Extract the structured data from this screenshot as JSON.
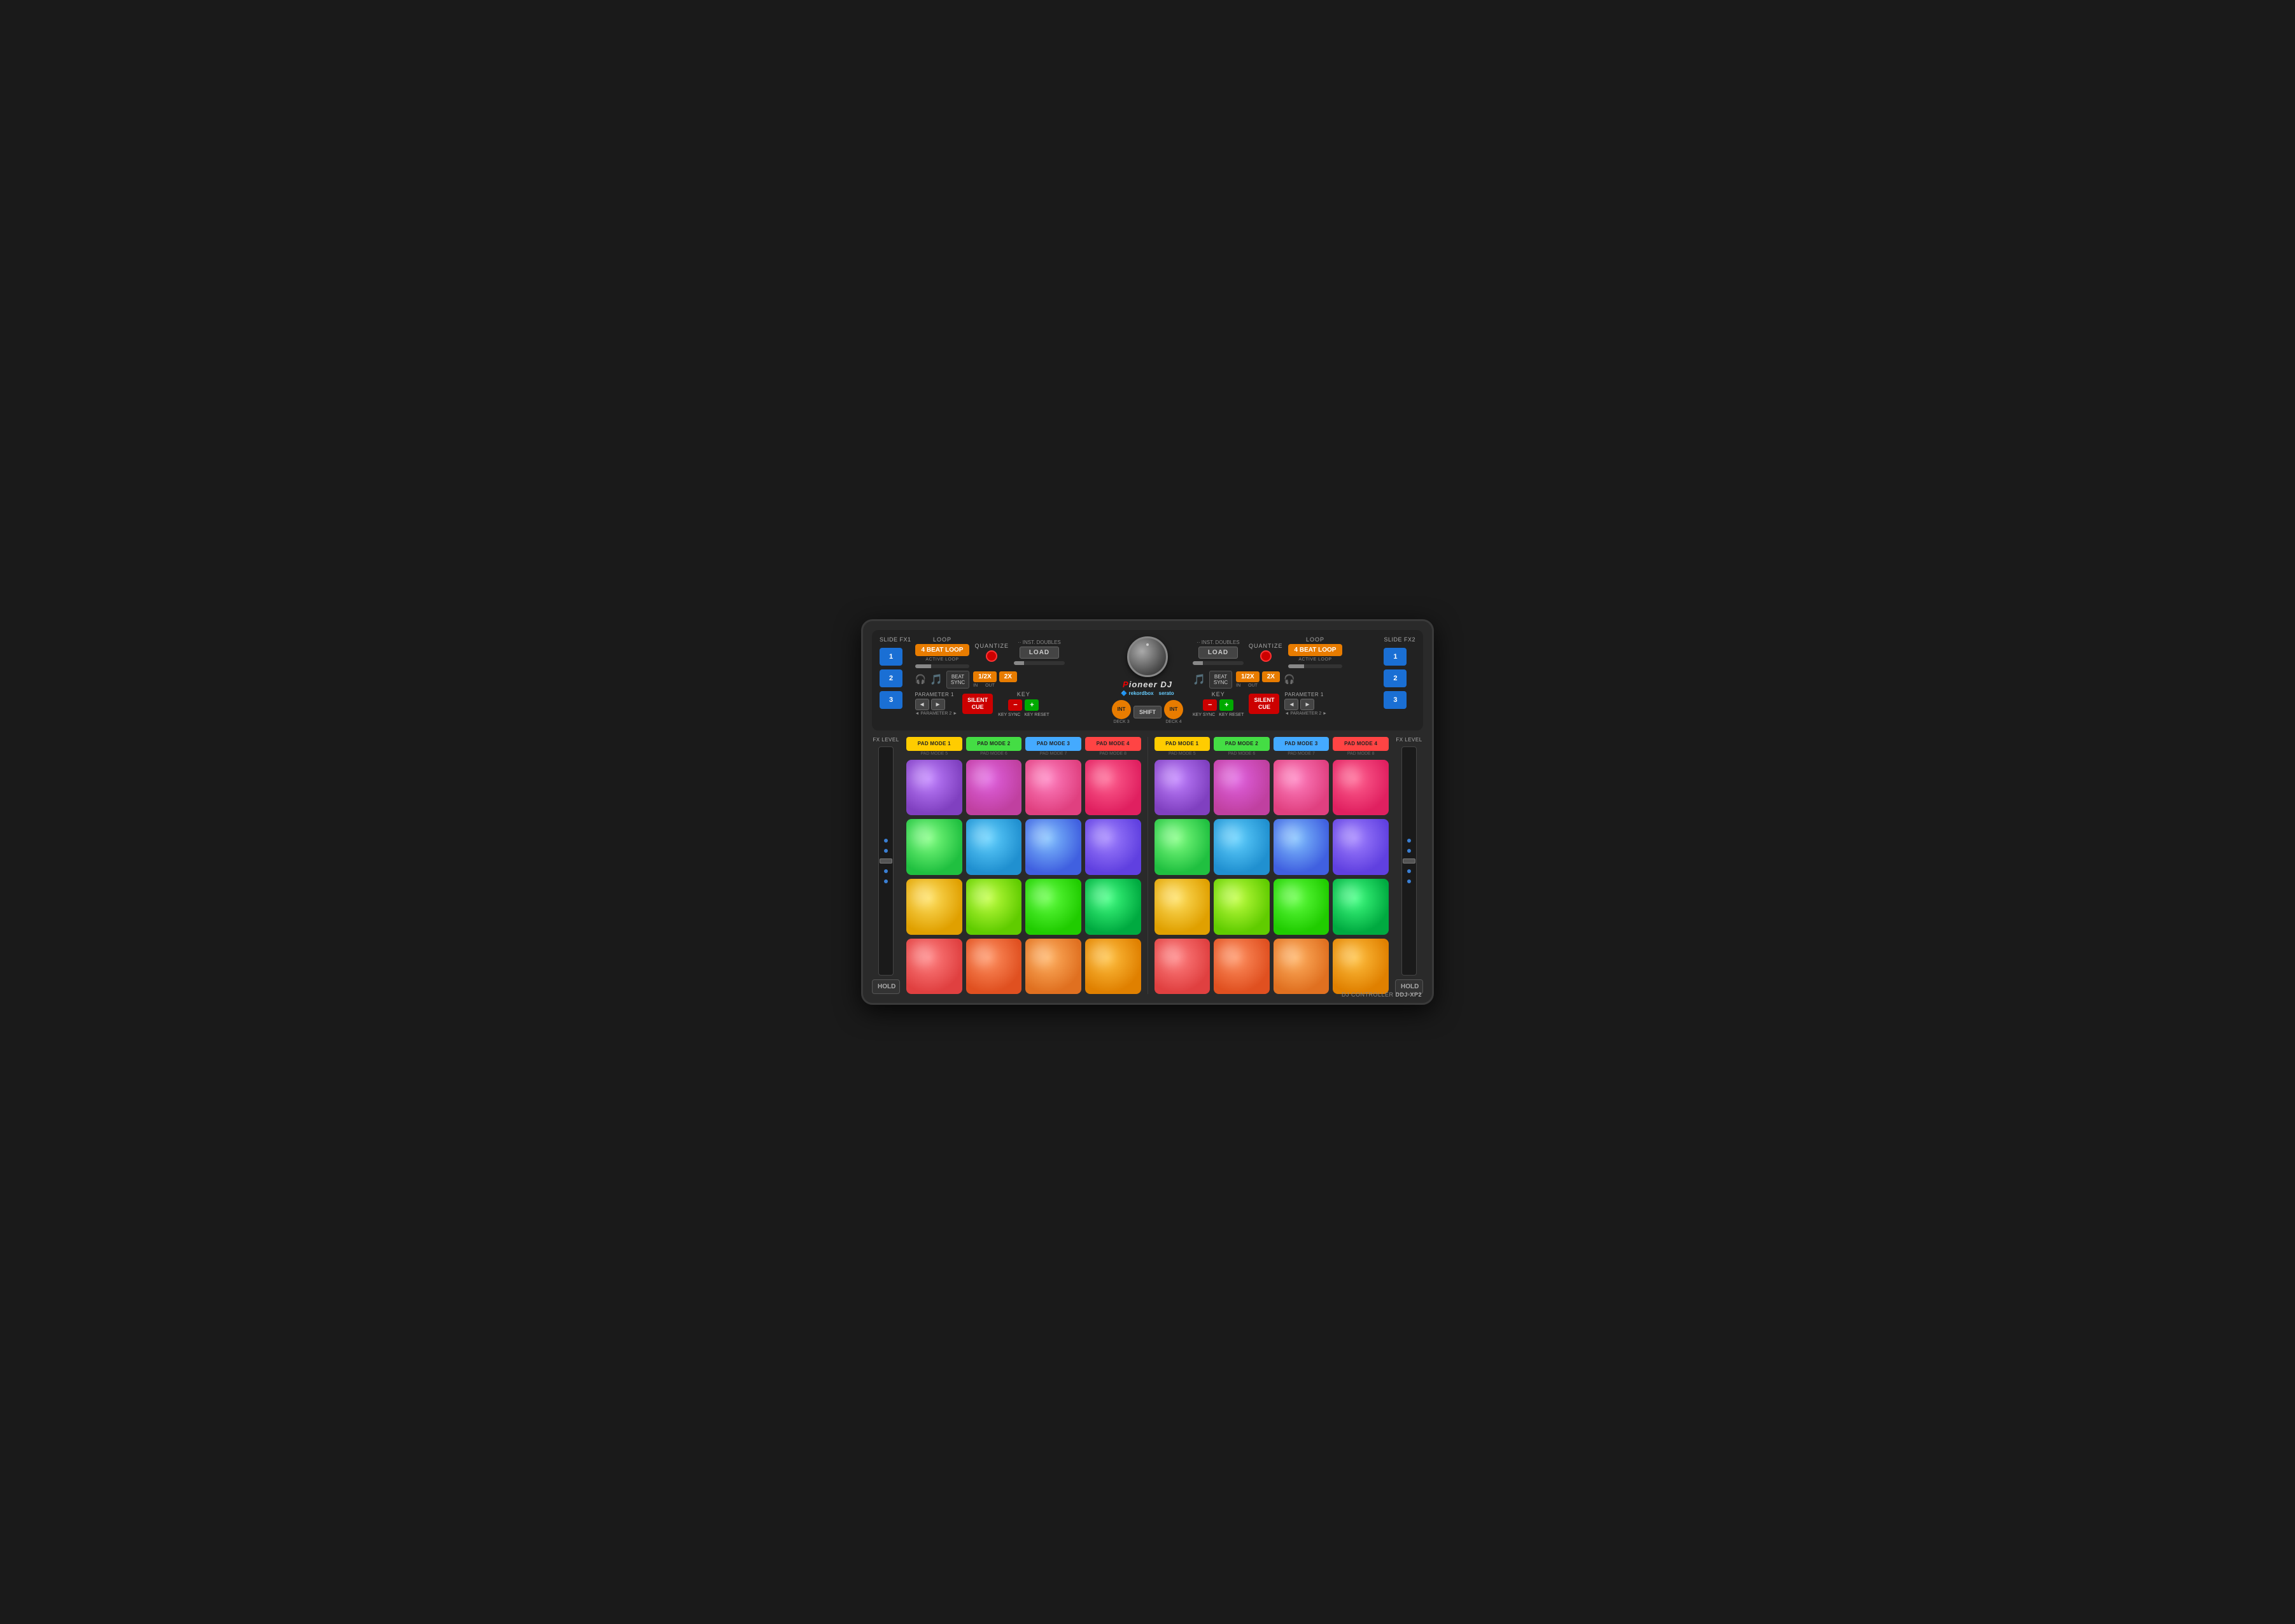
{
  "device": {
    "name": "DDJ-XP2",
    "brand": "Pioneer DJ",
    "type": "DJ CONTROLLER",
    "software": [
      "rekordbox",
      "serato"
    ]
  },
  "slide_fx": {
    "left_label": "SLIDE FX1",
    "right_label": "SLIDE FX2",
    "buttons": [
      "1",
      "2",
      "3"
    ]
  },
  "left_deck": {
    "loop_label": "LOOP",
    "loop_value": "4 BEAT LOOP",
    "active_loop": "ACTIVE LOOP",
    "quantize_label": "QUANTIZE",
    "inst_doubles": "·· INST. DOUBLES",
    "load_label": "LOAD",
    "half_label": "1/2X",
    "two_label": "2X",
    "in_label": "IN",
    "out_label": "OUT",
    "beat_sync": "BEAT SYNC",
    "parameter1": "PARAMETER 1",
    "parameter2": "◄ PARAMETER 2 ►",
    "silent_cue": "SILENT CUE",
    "key_label": "KEY",
    "key_sync": "KEY SYNC",
    "key_reset": "KEY RESET",
    "deck3_label": "DECK 3"
  },
  "right_deck": {
    "loop_label": "LOOP",
    "loop_value": "4 BEAT LOOP",
    "active_loop": "ACTIVE LOOP",
    "quantize_label": "QUANTIZE",
    "inst_doubles": "·· INST. DOUBLES",
    "load_label": "LOAD",
    "half_label": "1/2X",
    "two_label": "2X",
    "in_label": "IN",
    "out_label": "OUT",
    "beat_sync": "BEAT SYNC",
    "parameter1": "PARAMETER 1",
    "parameter2": "◄ PARAMETER 2 ►",
    "silent_cue": "SILENT CUE",
    "key_label": "KEY",
    "key_sync": "KEY SYNC",
    "key_reset": "KEY RESET",
    "deck4_label": "DECK 4"
  },
  "center": {
    "shift_label": "SHIFT",
    "int_deck3": "INT",
    "int_deck4": "INT",
    "deck3_sub": "DECK 3",
    "deck4_sub": "DECK 4"
  },
  "pad_modes_left": [
    {
      "label": "PAD MODE 1",
      "sub": "PAD MODE 5",
      "color": "yellow"
    },
    {
      "label": "PAD MODE 2",
      "sub": "PAD MODE 6",
      "color": "green"
    },
    {
      "label": "PAD MODE 3",
      "sub": "PAD MODE 7",
      "color": "blue"
    },
    {
      "label": "PAD MODE 4",
      "sub": "PAD MODE 8",
      "color": "red"
    }
  ],
  "pad_modes_right": [
    {
      "label": "PAD MODE 1",
      "sub": "PAD MODE 5",
      "color": "yellow"
    },
    {
      "label": "PAD MODE 2",
      "sub": "PAD MODE 6",
      "color": "green"
    },
    {
      "label": "PAD MODE 3",
      "sub": "PAD MODE 7",
      "color": "blue"
    },
    {
      "label": "PAD MODE 4",
      "sub": "PAD MODE 8",
      "color": "red"
    }
  ],
  "fx_level": {
    "left_label": "FX LEVEL",
    "right_label": "FX LEVEL",
    "hold_label": "HOLD"
  }
}
